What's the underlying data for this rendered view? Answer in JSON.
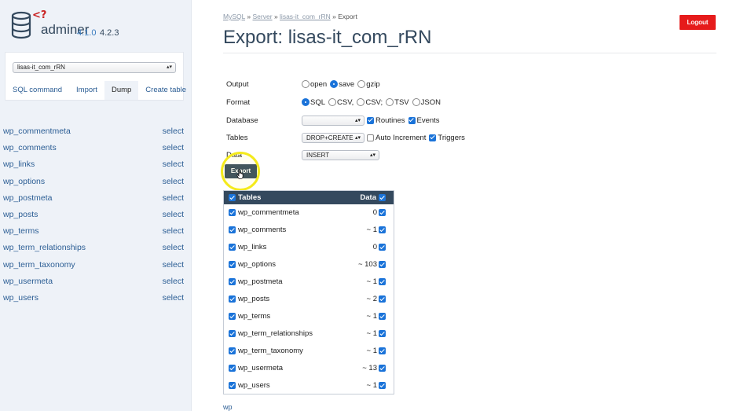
{
  "app": {
    "name": "adminer",
    "version": "4.1.0",
    "new_version": "4.2.3",
    "logo_mark": "<?"
  },
  "sidebar": {
    "db_select": {
      "value": "lisas-it_com_rRN"
    },
    "links": [
      {
        "label": "SQL command",
        "active": false
      },
      {
        "label": "Import",
        "active": false
      },
      {
        "label": "Dump",
        "active": true
      },
      {
        "label": "Create table",
        "active": false
      }
    ],
    "select_label": "select",
    "tables": [
      "wp_commentmeta",
      "wp_comments",
      "wp_links",
      "wp_options",
      "wp_postmeta",
      "wp_posts",
      "wp_terms",
      "wp_term_relationships",
      "wp_term_taxonomy",
      "wp_usermeta",
      "wp_users"
    ]
  },
  "breadcrumb": {
    "items": [
      "MySQL",
      "Server",
      "lisas-it_com_rRN"
    ],
    "current": "Export",
    "separator": "»"
  },
  "page": {
    "title": "Export: lisas-it_com_rRN",
    "logout_label": "Logout"
  },
  "form": {
    "output": {
      "label": "Output",
      "options": [
        "open",
        "save",
        "gzip"
      ],
      "selected": "save"
    },
    "format": {
      "label": "Format",
      "options": [
        "SQL",
        "CSV,",
        "CSV;",
        "TSV",
        "JSON"
      ],
      "selected": "SQL"
    },
    "database": {
      "label": "Database",
      "select_value": "",
      "routines_label": "Routines",
      "routines": true,
      "events_label": "Events",
      "events": true
    },
    "tables": {
      "label": "Tables",
      "select_value": "DROP+CREATE",
      "auto_increment_label": "Auto Increment",
      "auto_increment": false,
      "triggers_label": "Triggers",
      "triggers": true
    },
    "data": {
      "label": "Data",
      "select_value": "INSERT"
    },
    "export_label": "Export"
  },
  "export_table": {
    "header": {
      "tables": "Tables",
      "data": "Data"
    },
    "rows": [
      {
        "name": "wp_commentmeta",
        "rows": "0"
      },
      {
        "name": "wp_comments",
        "rows": "~ 1"
      },
      {
        "name": "wp_links",
        "rows": "0"
      },
      {
        "name": "wp_options",
        "rows": "~ 103"
      },
      {
        "name": "wp_postmeta",
        "rows": "~ 1"
      },
      {
        "name": "wp_posts",
        "rows": "~ 2"
      },
      {
        "name": "wp_terms",
        "rows": "~ 1"
      },
      {
        "name": "wp_term_relationships",
        "rows": "~ 1"
      },
      {
        "name": "wp_term_taxonomy",
        "rows": "~ 1"
      },
      {
        "name": "wp_usermeta",
        "rows": "~ 13"
      },
      {
        "name": "wp_users",
        "rows": "~ 1"
      }
    ]
  },
  "bottom_link": "wp",
  "colors": {
    "accent": "#34495e",
    "link": "#2b5d94",
    "logout": "#e61b1b",
    "checkbox": "#1a73d9",
    "highlight": "#f4ea1c"
  }
}
